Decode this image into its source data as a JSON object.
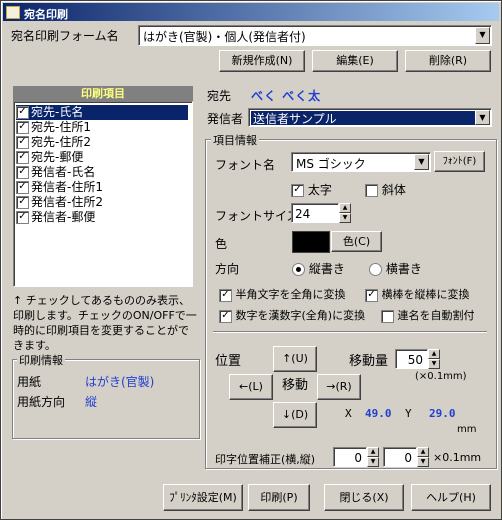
{
  "window": {
    "title": "宛名印刷"
  },
  "form_select": {
    "label": "宛名印刷フォーム名",
    "value": "はがき(官製)・個人(発信者付)"
  },
  "top_buttons": {
    "new": "新規作成(N)",
    "edit": "編集(E)",
    "delete": "削除(R)"
  },
  "print_items": {
    "header": "印刷項目",
    "items": [
      {
        "label": "宛先-氏名",
        "checked": true,
        "selected": true
      },
      {
        "label": "宛先-住所1",
        "checked": true
      },
      {
        "label": "宛先-住所2",
        "checked": true
      },
      {
        "label": "宛先-郵便",
        "checked": true
      },
      {
        "label": "発信者-氏名",
        "checked": true
      },
      {
        "label": "発信者-住所1",
        "checked": true
      },
      {
        "label": "発信者-住所2",
        "checked": true
      },
      {
        "label": "発信者-郵便",
        "checked": true
      }
    ],
    "note": "↑ チェックしてあるもののみ表示、印刷します。チェックのON/OFFで一時的に印刷項目を変更することができます。"
  },
  "print_info": {
    "title": "印刷情報",
    "paper_label": "用紙",
    "paper_value": "はがき(官製)",
    "orientation_label": "用紙方向",
    "orientation_value": "縦"
  },
  "destination": {
    "label": "宛先",
    "value": "べく べく太"
  },
  "sender": {
    "label": "発信者",
    "value": "送信者サンプル"
  },
  "item_info": {
    "title": "項目情報",
    "font_label": "フォント名",
    "font_value": "MS ゴシック",
    "font_button": "ﾌｫﾝﾄ(F)",
    "bold_label": "太字",
    "bold_checked": true,
    "italic_label": "斜体",
    "italic_checked": false,
    "size_label": "フォントサイズ",
    "size_value": "24",
    "color_label": "色",
    "color_button": "色(C)",
    "color_value": "#000000",
    "direction_label": "方向",
    "vertical_label": "縦書き",
    "horizontal_label": "横書き",
    "vertical_selected": true,
    "opt1": "半角文字を全角に変換",
    "opt1_checked": true,
    "opt2": "横棒を縦棒に変換",
    "opt2_checked": true,
    "opt3": "数字を漢数字(全角)に変換",
    "opt3_checked": true,
    "opt4": "連名を自動割付",
    "opt4_checked": false
  },
  "position": {
    "label": "位置",
    "up": "↑(U)",
    "left": "←(L)",
    "center": "移動",
    "right": "→(R)",
    "down": "↓(D)",
    "move_label": "移動量",
    "move_value": "50",
    "move_unit": "(×0.1mm)",
    "x_label": "X",
    "x_value": "49.0",
    "y_label": "Y",
    "y_value": "29.0",
    "unit": "mm"
  },
  "correction": {
    "label": "印字位置補正(横,縦)",
    "h_value": "0",
    "v_value": "0",
    "unit": "×0.1mm"
  },
  "bottom_buttons": {
    "printer": "ﾌﾟﾘﾝﾀ設定(M)",
    "print": "印刷(P)",
    "close": "閉じる(X)",
    "help": "ヘルプ(H)"
  }
}
